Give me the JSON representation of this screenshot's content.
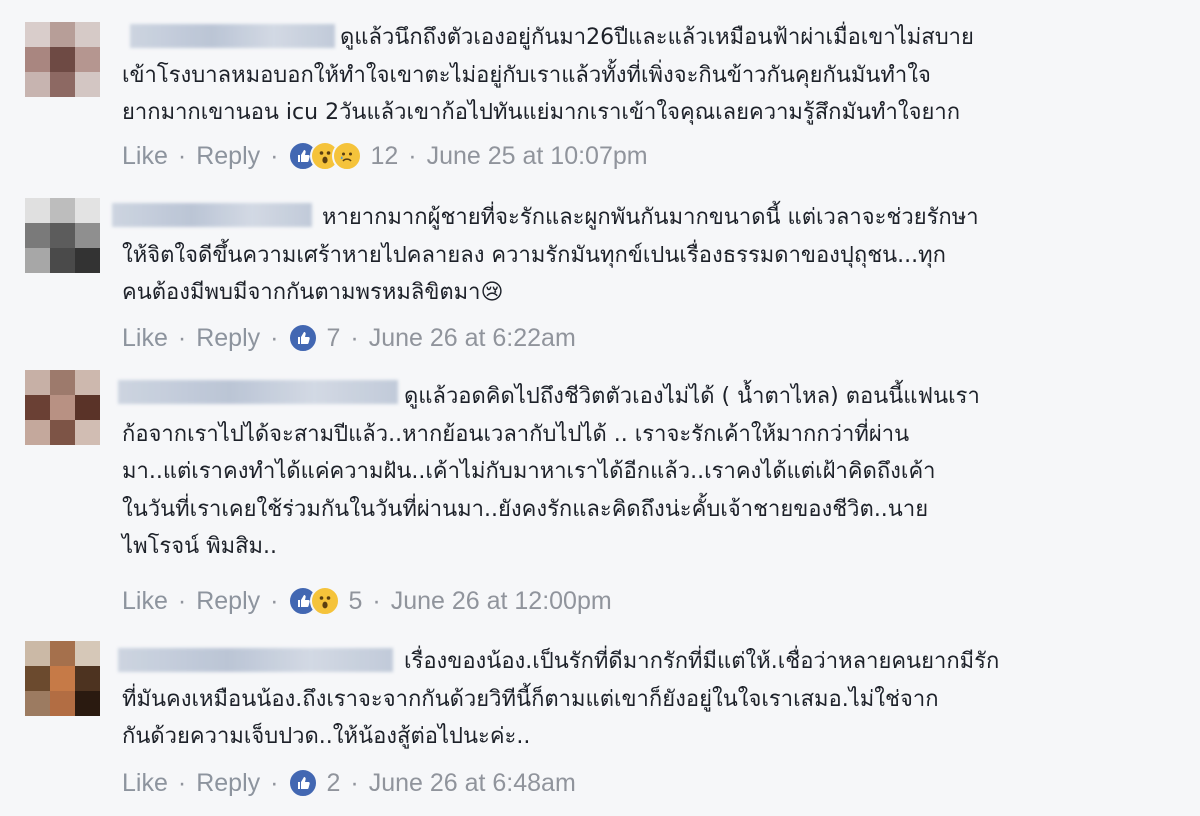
{
  "comments": [
    {
      "lines": [
        "ดูแล้วนึกถึงตัวเองอยู่กันมา26ปีและแล้วเหมือนฟ้าผ่าเมื่อเขาไม่สบาย",
        "เข้าโรงบาลหมอบอกให้ทำใจเขาตะไม่อยู่กับเราแล้วทั้งที่เพิ่งจะกินข้าวกันคุยกันมันทำใจ",
        "ยากมากเขานอน icu 2วันแล้วเขาก้อไปทันแย่มากเราเข้าใจคุณเลยความรู้สึกมันทำใจยาก"
      ],
      "like": "Like",
      "reply": "Reply",
      "reactions": [
        "like-icon",
        "wow-icon",
        "sad-icon"
      ],
      "count": "12",
      "time": "June 25 at 10:07pm"
    },
    {
      "lines": [
        "หายากมากผู้ชายที่จะรักและผูกพันกันมากขนาดนี้ แต่เวลาจะช่วยรักษา",
        "ให้จิตใจดีขึ้นความเศร้าหายไปคลายลง ความรักมันทุกข์เปนเรื่องธรรมดาของปุถุชน...ทุก",
        "คนต้องมีพบมีจากกันตามพรหมลิขิตมา😢"
      ],
      "like": "Like",
      "reply": "Reply",
      "reactions": [
        "like-icon"
      ],
      "count": "7",
      "time": "June 26 at 6:22am"
    },
    {
      "lines": [
        "ดูแล้วอดคิดไปถึงชีวิตตัวเองไม่ได้ ( น้ำตาไหล) ตอนนี้แฟนเรา",
        "ก้อจากเราไปได้จะสามปีแล้ว..หากย้อนเวลากับไปได้ .. เราจะรักเค้าให้มากกว่าที่ผ่าน",
        "มา..แต่เราคงทำได้แค่ความฝัน..เค้าไม่กับมาหาเราได้อีกแล้ว..เราคงได้แต่เฝ้าคิดถึงเค้า",
        "ในวันที่เราเคยใช้ร่วมกันในวันที่ผ่านมา..ยังคงรักและคิดถึงน่ะคั้บเจ้าชายของชีวิต..นาย",
        "ไพโรจน์ พิมสิม.."
      ],
      "like": "Like",
      "reply": "Reply",
      "reactions": [
        "like-icon",
        "wow-icon"
      ],
      "count": "5",
      "time": "June 26 at 12:00pm"
    },
    {
      "lines": [
        "เรื่องของน้อง.เป็นรักที่ดีมากรักที่มีแต่ให้.เชื่อว่าหลายคนยากมีรัก",
        "ที่มันคงเหมือนน้อง.ถึงเราจะจากกันด้วยวิทีนี้ก็ตามแต่เขาก็ยังอยู่ในใจเราเสมอ.ไม่ใช่จาก",
        "กันด้วยความเจ็บปวด..ให้น้องสู้ต่อไปนะค่ะ.."
      ],
      "like": "Like",
      "reply": "Reply",
      "reactions": [
        "like-icon"
      ],
      "count": "2",
      "time": "June 26 at 6:48am"
    }
  ],
  "separator": "·"
}
